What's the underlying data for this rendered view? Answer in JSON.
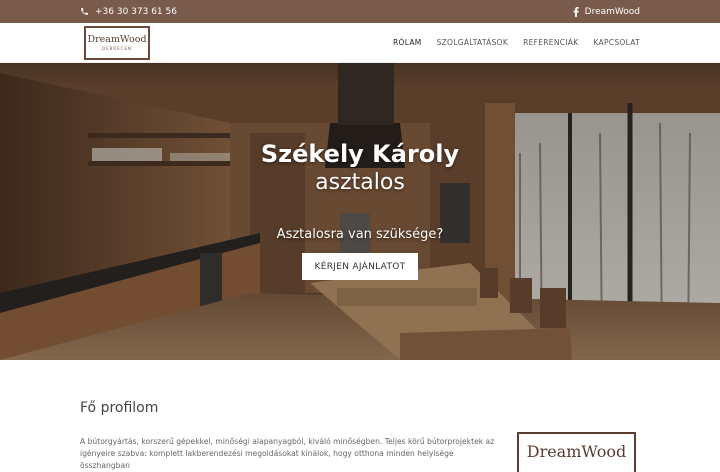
{
  "topbar": {
    "phone": "+36 30 373 61 56",
    "phone_icon": "phone-icon",
    "facebook_label": "DreamWood",
    "facebook_icon": "facebook-icon"
  },
  "logo": {
    "name": "DreamWood",
    "city": "DEBRECEN"
  },
  "nav": {
    "items": [
      {
        "label": "RÓLAM"
      },
      {
        "label": "SZOLGÁLTATÁSOK"
      },
      {
        "label": "REFERENCIÁK"
      },
      {
        "label": "KAPCSOLAT"
      }
    ]
  },
  "hero": {
    "name": "Székely Károly",
    "profession": "asztalos",
    "question": "Asztalosra van szüksége?",
    "cta_label": "KÉRJEN AJÁNLATOT"
  },
  "profile": {
    "title": "Fő profilom",
    "text": "A bútorgyártás, korszerű gépekkel, minőségi alapanyagból, kiváló minőségben. Teljes körű bútorprojektek az igényeire szabva: komplett lakberendezési megoldásokat kínálok, hogy otthona minden helyisége összhangban",
    "logo_text": "DreamWood"
  },
  "colors": {
    "brand_brown": "#7a5a4a",
    "logo_border": "#6b4a3a"
  }
}
